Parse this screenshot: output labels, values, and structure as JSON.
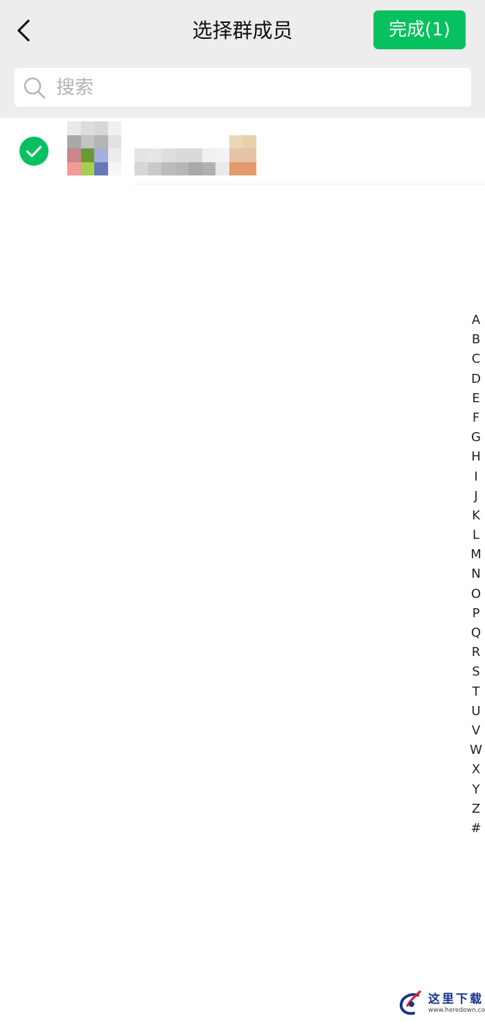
{
  "header": {
    "title": "选择群成员",
    "done_label": "完成(1)",
    "back_icon": "chevron-left-icon"
  },
  "search": {
    "placeholder": "搜索",
    "value": "",
    "icon": "search-icon"
  },
  "members": [
    {
      "selected": true,
      "check_icon": "check-circle-icon",
      "name_blurred": true,
      "avatar_blurred": true
    }
  ],
  "index_letters": [
    "A",
    "B",
    "C",
    "D",
    "E",
    "F",
    "G",
    "H",
    "I",
    "J",
    "K",
    "L",
    "M",
    "N",
    "O",
    "P",
    "Q",
    "R",
    "S",
    "T",
    "U",
    "V",
    "W",
    "X",
    "Y",
    "Z",
    "#"
  ],
  "watermark": {
    "text": "这里下载",
    "url": "www.heredown.com"
  },
  "colors": {
    "accent": "#07c160",
    "header_bg": "#ededed",
    "page_bg": "#ffffff",
    "placeholder": "#b2b2b2",
    "watermark_blue": "#16338f",
    "watermark_red": "#d8262c"
  }
}
